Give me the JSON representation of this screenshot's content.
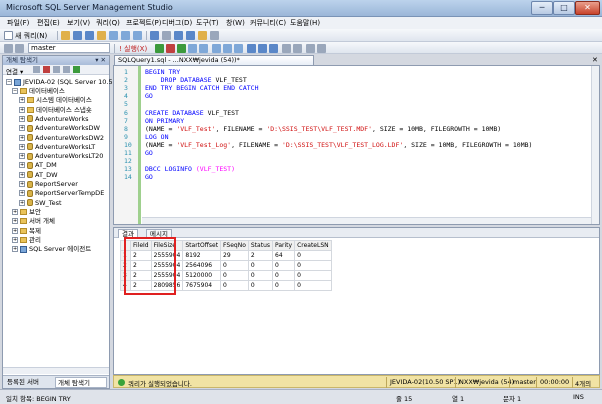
{
  "window": {
    "title": "Microsoft SQL Server Management Studio",
    "minimize": "─",
    "maximize": "□",
    "close": "✕"
  },
  "menu": [
    "파일(F)",
    "편집(E)",
    "보기(V)",
    "쿼리(Q)",
    "프로젝트(P)",
    "디버그(D)",
    "도구(T)",
    "창(W)",
    "커뮤니티(C)",
    "도움말(H)"
  ],
  "toolbar1": {
    "new_query": "새 쿼리(N)"
  },
  "toolbar2": {
    "database": "master",
    "execute": "! 실행(X)"
  },
  "object_explorer": {
    "title": "개체 탐색기",
    "pin": "▾ ✕",
    "connect": "연결 ▾",
    "server": "JEVIDA-02 (SQL Server 10.5",
    "items": [
      {
        "label": "데이터베이스",
        "type": "folder",
        "expander": "−"
      },
      {
        "label": "시스템 데이터베이스",
        "type": "folder",
        "expander": "+"
      },
      {
        "label": "데이터베이스 스냅숏",
        "type": "folder",
        "expander": "+"
      },
      {
        "label": "AdventureWorks",
        "type": "db",
        "expander": "+"
      },
      {
        "label": "AdventureWorksDW",
        "type": "db",
        "expander": "+"
      },
      {
        "label": "AdventureWorksDW2",
        "type": "db",
        "expander": "+"
      },
      {
        "label": "AdventureWorksLT",
        "type": "db",
        "expander": "+"
      },
      {
        "label": "AdventureWorksLT20",
        "type": "db",
        "expander": "+"
      },
      {
        "label": "AT_DM",
        "type": "db",
        "expander": "+"
      },
      {
        "label": "AT_DW",
        "type": "db",
        "expander": "+"
      },
      {
        "label": "ReportServer",
        "type": "db",
        "expander": "+"
      },
      {
        "label": "ReportServerTempDE",
        "type": "db",
        "expander": "+"
      },
      {
        "label": "SW_Test",
        "type": "db",
        "expander": "+"
      },
      {
        "label": "보안",
        "type": "folder",
        "expander": "+"
      },
      {
        "label": "서버 개체",
        "type": "folder",
        "expander": "+"
      },
      {
        "label": "복제",
        "type": "folder",
        "expander": "+"
      },
      {
        "label": "관리",
        "type": "folder",
        "expander": "+"
      },
      {
        "label": "SQL Server 에이전트",
        "type": "srv",
        "expander": "+"
      }
    ],
    "tabs": [
      "등록된 서버",
      "개체 탐색기"
    ]
  },
  "editor": {
    "tab_label": "SQLQuery1.sql - ...NXX₩jevida (54))*",
    "close": "✕",
    "lines": [
      [
        {
          "t": "BEGIN TRY",
          "c": "kw"
        }
      ],
      [
        {
          "t": "    DROP DATABASE ",
          "c": "kw"
        },
        {
          "t": "VLF_TEST",
          "c": "id"
        }
      ],
      [
        {
          "t": "END TRY BEGIN CATCH END CATCH",
          "c": "kw"
        }
      ],
      [
        {
          "t": "GO",
          "c": "kw"
        }
      ],
      [
        {
          "t": "",
          "c": "id"
        }
      ],
      [
        {
          "t": "CREATE DATABASE ",
          "c": "kw"
        },
        {
          "t": "VLF_TEST",
          "c": "id"
        }
      ],
      [
        {
          "t": "ON PRIMARY",
          "c": "kw"
        }
      ],
      [
        {
          "t": "(NAME = ",
          "c": "id"
        },
        {
          "t": "'VLF_Test'",
          "c": "str"
        },
        {
          "t": ", FILENAME = ",
          "c": "id"
        },
        {
          "t": "'D:\\SSIS_TEST\\VLF_TEST.MDF'",
          "c": "str"
        },
        {
          "t": ", SIZE = 10MB, FILEGROWTH = 10MB)",
          "c": "id"
        }
      ],
      [
        {
          "t": "LOG ON",
          "c": "kw"
        }
      ],
      [
        {
          "t": "(NAME = ",
          "c": "id"
        },
        {
          "t": "'VLF_Test_Log'",
          "c": "str"
        },
        {
          "t": ", FILENAME = ",
          "c": "id"
        },
        {
          "t": "'D:\\SSIS_TEST\\VLF_TEST_LOG.LDF'",
          "c": "str"
        },
        {
          "t": ", SIZE = 10MB, FILEGROWTH = 10MB)",
          "c": "id"
        }
      ],
      [
        {
          "t": "GO",
          "c": "kw"
        }
      ],
      [
        {
          "t": "",
          "c": "id"
        }
      ],
      [
        {
          "t": "DBCC LOGINFO ",
          "c": "kw"
        },
        {
          "t": "(VLF_TEST)",
          "c": "pink"
        }
      ],
      [
        {
          "t": "GO",
          "c": "kw"
        }
      ]
    ]
  },
  "results": {
    "tabs": [
      "결과",
      "메시지"
    ],
    "columns": [
      "FileId",
      "FileSize",
      "StartOffset",
      "FSeqNo",
      "Status",
      "Parity",
      "CreateLSN"
    ],
    "rows": [
      [
        "1",
        "2",
        "2555904",
        "8192",
        "29",
        "2",
        "64",
        "0"
      ],
      [
        "2",
        "2",
        "2555904",
        "2564096",
        "0",
        "0",
        "0",
        "0"
      ],
      [
        "3",
        "2",
        "2555904",
        "5120000",
        "0",
        "0",
        "0",
        "0"
      ],
      [
        "4",
        "2",
        "2809856",
        "7675904",
        "0",
        "0",
        "0",
        "0"
      ]
    ]
  },
  "query_status": {
    "message": "쿼리가 실행되었습니다.",
    "server": "JEVIDA-02(10.50 SP1)",
    "user": "NXX₩jevida (54)",
    "database": "master",
    "elapsed": "00:00:00",
    "rows": "4개의 행"
  },
  "statusbar": {
    "left": "일치 항목: BEGIN TRY",
    "line": "줄 15",
    "col": "열 1",
    "ch": "문자 1",
    "mode": "INS"
  },
  "colors": {
    "keyword": "#0000ff",
    "string": "#d01010",
    "highlight_box": "#e02020",
    "status_bar": "#f1e3a4"
  }
}
